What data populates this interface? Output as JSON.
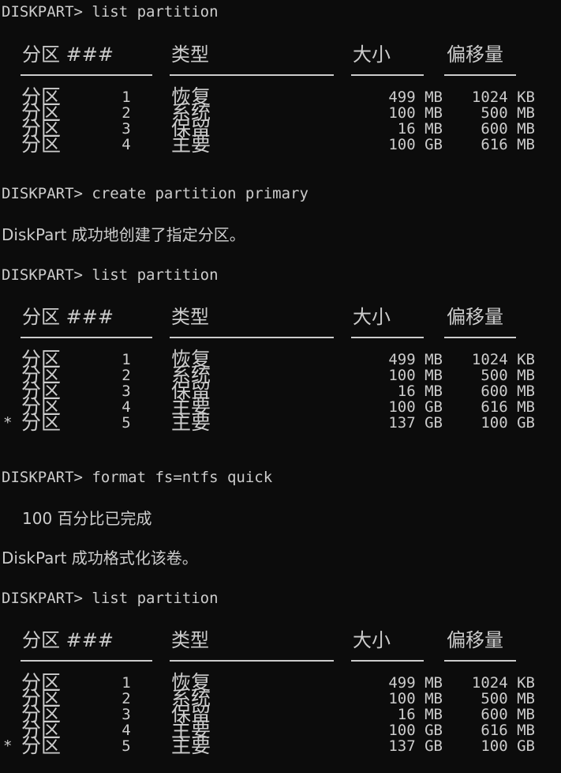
{
  "console": {
    "prompt_1": "DISKPART> list partition",
    "prompt_2": "DISKPART> create partition primary",
    "msg_1": "DiskPart 成功地创建了指定分区。",
    "prompt_3": "DISKPART> list partition",
    "prompt_4": "DISKPART> format fs=ntfs quick",
    "progress": "100 百分比已完成",
    "msg_2": "DiskPart 成功格式化该卷。",
    "prompt_5": "DISKPART> list partition"
  },
  "table_headers": {
    "partition": "分区 ###",
    "type": "类型",
    "size": "大小",
    "offset": "偏移量"
  },
  "tables": [
    {
      "rows": [
        {
          "star": "",
          "name": "分区",
          "num": "1",
          "type": "恢复",
          "size": "499 MB",
          "offset": "1024 KB"
        },
        {
          "star": "",
          "name": "分区",
          "num": "2",
          "type": "系统",
          "size": "100 MB",
          "offset": "500 MB"
        },
        {
          "star": "",
          "name": "分区",
          "num": "3",
          "type": "保留",
          "size": "16 MB",
          "offset": "600 MB"
        },
        {
          "star": "",
          "name": "分区",
          "num": "4",
          "type": "主要",
          "size": "100 GB",
          "offset": "616 MB"
        }
      ]
    },
    {
      "rows": [
        {
          "star": "",
          "name": "分区",
          "num": "1",
          "type": "恢复",
          "size": "499 MB",
          "offset": "1024 KB"
        },
        {
          "star": "",
          "name": "分区",
          "num": "2",
          "type": "系统",
          "size": "100 MB",
          "offset": "500 MB"
        },
        {
          "star": "",
          "name": "分区",
          "num": "3",
          "type": "保留",
          "size": "16 MB",
          "offset": "600 MB"
        },
        {
          "star": "",
          "name": "分区",
          "num": "4",
          "type": "主要",
          "size": "100 GB",
          "offset": "616 MB"
        },
        {
          "star": "*",
          "name": "分区",
          "num": "5",
          "type": "主要",
          "size": "137 GB",
          "offset": "100 GB"
        }
      ]
    },
    {
      "rows": [
        {
          "star": "",
          "name": "分区",
          "num": "1",
          "type": "恢复",
          "size": "499 MB",
          "offset": "1024 KB"
        },
        {
          "star": "",
          "name": "分区",
          "num": "2",
          "type": "系统",
          "size": "100 MB",
          "offset": "500 MB"
        },
        {
          "star": "",
          "name": "分区",
          "num": "3",
          "type": "保留",
          "size": "16 MB",
          "offset": "600 MB"
        },
        {
          "star": "",
          "name": "分区",
          "num": "4",
          "type": "主要",
          "size": "100 GB",
          "offset": "616 MB"
        },
        {
          "star": "*",
          "name": "分区",
          "num": "5",
          "type": "主要",
          "size": "137 GB",
          "offset": "100 GB"
        }
      ]
    }
  ]
}
